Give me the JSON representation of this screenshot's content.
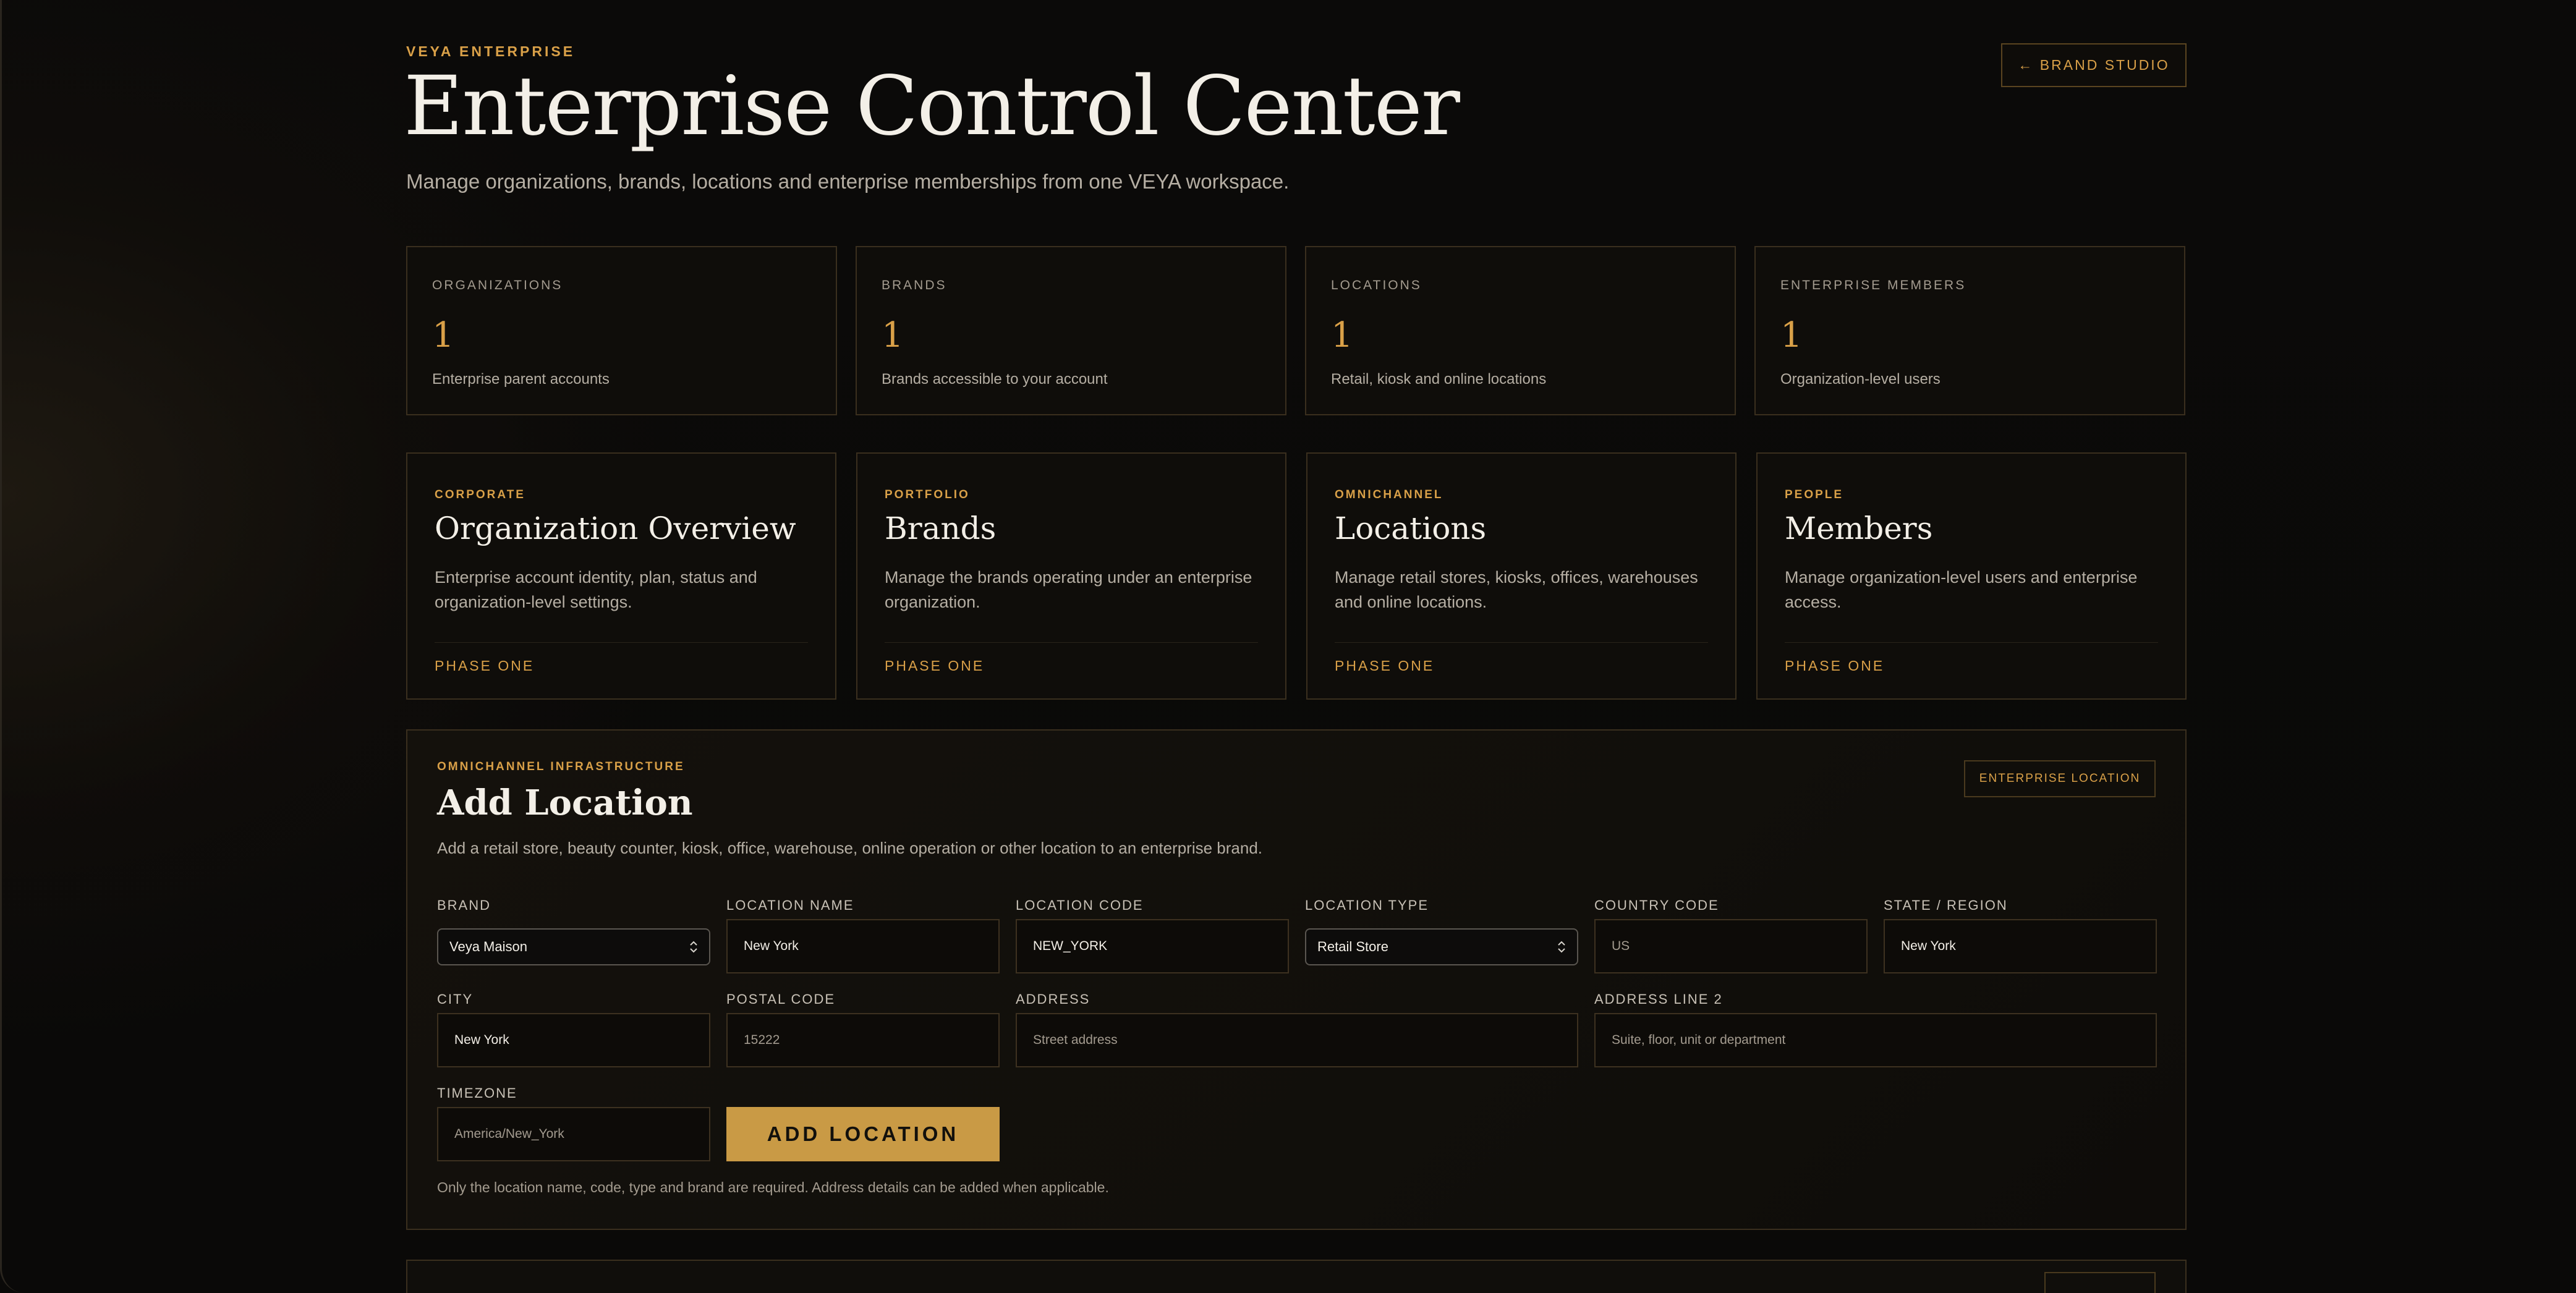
{
  "header": {
    "eyebrow": "VEYA ENTERPRISE",
    "title": "Enterprise Control Center",
    "subtitle": "Manage organizations, brands, locations and enterprise memberships from one VEYA workspace.",
    "back_button": "← BRAND STUDIO"
  },
  "stats": [
    {
      "label": "ORGANIZATIONS",
      "value": "1",
      "desc": "Enterprise parent accounts"
    },
    {
      "label": "BRANDS",
      "value": "1",
      "desc": "Brands accessible to your account"
    },
    {
      "label": "LOCATIONS",
      "value": "1",
      "desc": "Retail, kiosk and online locations"
    },
    {
      "label": "ENTERPRISE MEMBERS",
      "value": "1",
      "desc": "Organization-level users"
    }
  ],
  "features": [
    {
      "tag": "CORPORATE",
      "title": "Organization Overview",
      "desc": "Enterprise account identity, plan, status and organization-level settings.",
      "phase": "PHASE ONE"
    },
    {
      "tag": "PORTFOLIO",
      "title": "Brands",
      "desc": "Manage the brands operating under an enterprise organization.",
      "phase": "PHASE ONE"
    },
    {
      "tag": "OMNICHANNEL",
      "title": "Locations",
      "desc": "Manage retail stores, kiosks, offices, warehouses and online locations.",
      "phase": "PHASE ONE"
    },
    {
      "tag": "PEOPLE",
      "title": "Members",
      "desc": "Manage organization-level users and enterprise access.",
      "phase": "PHASE ONE"
    }
  ],
  "add_location": {
    "tag": "OMNICHANNEL INFRASTRUCTURE",
    "title": "Add Location",
    "desc": "Add a retail store, beauty counter, kiosk, office, warehouse, online operation or other location to an enterprise brand.",
    "badge": "ENTERPRISE LOCATION",
    "fields": {
      "brand": {
        "label": "BRAND",
        "value": "Veya Maison"
      },
      "location_name": {
        "label": "LOCATION NAME",
        "value": "New York"
      },
      "location_code": {
        "label": "LOCATION CODE",
        "value": "NEW_YORK"
      },
      "location_type": {
        "label": "LOCATION TYPE",
        "value": "Retail Store"
      },
      "country_code": {
        "label": "COUNTRY CODE",
        "placeholder": "US"
      },
      "state_region": {
        "label": "STATE / REGION",
        "value": "New York"
      },
      "city": {
        "label": "CITY",
        "value": "New York"
      },
      "postal_code": {
        "label": "POSTAL CODE",
        "placeholder": "15222"
      },
      "address": {
        "label": "ADDRESS",
        "placeholder": "Street address"
      },
      "address_line_2": {
        "label": "ADDRESS LINE 2",
        "placeholder": "Suite, floor, unit or department"
      },
      "timezone": {
        "label": "TIMEZONE",
        "placeholder": "America/New_York"
      }
    },
    "submit": "ADD LOCATION",
    "note": "Only the location name, code, type and brand are required. Address details can be added when applicable."
  }
}
